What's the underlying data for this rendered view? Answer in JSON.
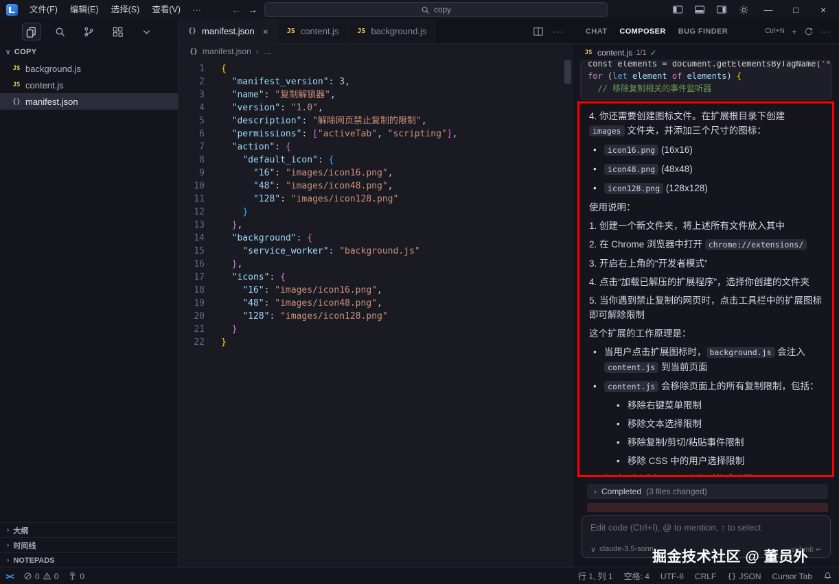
{
  "icons": {
    "js": "JS",
    "json": "{}"
  },
  "titlebar": {
    "menus": [
      "文件(F)",
      "编辑(E)",
      "选择(S)",
      "查看(V)"
    ],
    "more": "···",
    "back": "←",
    "forward": "→",
    "search_value": "copy",
    "window": {
      "minimize": "—",
      "maximize": "□",
      "close": "×"
    }
  },
  "sidebar": {
    "header": "COPY",
    "header_chevron": "∨",
    "files": [
      {
        "label": "background.js",
        "icon": "js"
      },
      {
        "label": "content.js",
        "icon": "js"
      },
      {
        "label": "manifest.json",
        "icon": "json",
        "active": true
      }
    ],
    "sections": [
      {
        "chevron": "›",
        "label": "大纲"
      },
      {
        "chevron": "›",
        "label": "时间线"
      },
      {
        "chevron": "›",
        "label": "NOTEPADS"
      }
    ]
  },
  "editor": {
    "tabs": [
      {
        "label": "manifest.json",
        "icon": "json",
        "active": true,
        "close": "×"
      },
      {
        "label": "content.js",
        "icon": "js"
      },
      {
        "label": "background.js",
        "icon": "js"
      }
    ],
    "breadcrumb": {
      "file": "manifest.json",
      "sep": "›",
      "more": "…"
    },
    "lines": [
      [
        [
          "b1",
          "{"
        ]
      ],
      [
        [
          "p",
          "  "
        ],
        [
          "k",
          "\"manifest_version\""
        ],
        [
          "p",
          ": "
        ],
        [
          "n",
          "3"
        ],
        [
          "p",
          ","
        ]
      ],
      [
        [
          "p",
          "  "
        ],
        [
          "k",
          "\"name\""
        ],
        [
          "p",
          ": "
        ],
        [
          "s",
          "\"复制解锁器\""
        ],
        [
          "p",
          ","
        ]
      ],
      [
        [
          "p",
          "  "
        ],
        [
          "k",
          "\"version\""
        ],
        [
          "p",
          ": "
        ],
        [
          "s",
          "\"1.0\""
        ],
        [
          "p",
          ","
        ]
      ],
      [
        [
          "p",
          "  "
        ],
        [
          "k",
          "\"description\""
        ],
        [
          "p",
          ": "
        ],
        [
          "s",
          "\"解除网页禁止复制的限制\""
        ],
        [
          "p",
          ","
        ]
      ],
      [
        [
          "p",
          "  "
        ],
        [
          "k",
          "\"permissions\""
        ],
        [
          "p",
          ": "
        ],
        [
          "b2",
          "["
        ],
        [
          "s",
          "\"activeTab\""
        ],
        [
          "p",
          ", "
        ],
        [
          "s",
          "\"scripting\""
        ],
        [
          "b2",
          "]"
        ],
        [
          "p",
          ","
        ]
      ],
      [
        [
          "p",
          "  "
        ],
        [
          "k",
          "\"action\""
        ],
        [
          "p",
          ": "
        ],
        [
          "b2",
          "{"
        ]
      ],
      [
        [
          "p",
          "    "
        ],
        [
          "k",
          "\"default_icon\""
        ],
        [
          "p",
          ": "
        ],
        [
          "b3",
          "{"
        ]
      ],
      [
        [
          "p",
          "      "
        ],
        [
          "k",
          "\"16\""
        ],
        [
          "p",
          ": "
        ],
        [
          "s",
          "\"images/icon16.png\""
        ],
        [
          "p",
          ","
        ]
      ],
      [
        [
          "p",
          "      "
        ],
        [
          "k",
          "\"48\""
        ],
        [
          "p",
          ": "
        ],
        [
          "s",
          "\"images/icon48.png\""
        ],
        [
          "p",
          ","
        ]
      ],
      [
        [
          "p",
          "      "
        ],
        [
          "k",
          "\"128\""
        ],
        [
          "p",
          ": "
        ],
        [
          "s",
          "\"images/icon128.png\""
        ]
      ],
      [
        [
          "p",
          "    "
        ],
        [
          "b3",
          "}"
        ]
      ],
      [
        [
          "p",
          "  "
        ],
        [
          "b2",
          "}"
        ],
        [
          "p",
          ","
        ]
      ],
      [
        [
          "p",
          "  "
        ],
        [
          "k",
          "\"background\""
        ],
        [
          "p",
          ": "
        ],
        [
          "b2",
          "{"
        ]
      ],
      [
        [
          "p",
          "    "
        ],
        [
          "k",
          "\"service_worker\""
        ],
        [
          "p",
          ": "
        ],
        [
          "s",
          "\"background.js\""
        ]
      ],
      [
        [
          "p",
          "  "
        ],
        [
          "b2",
          "}"
        ],
        [
          "p",
          ","
        ]
      ],
      [
        [
          "p",
          "  "
        ],
        [
          "k",
          "\"icons\""
        ],
        [
          "p",
          ": "
        ],
        [
          "b2",
          "{"
        ]
      ],
      [
        [
          "p",
          "    "
        ],
        [
          "k",
          "\"16\""
        ],
        [
          "p",
          ": "
        ],
        [
          "s",
          "\"images/icon16.png\""
        ],
        [
          "p",
          ","
        ]
      ],
      [
        [
          "p",
          "    "
        ],
        [
          "k",
          "\"48\""
        ],
        [
          "p",
          ": "
        ],
        [
          "s",
          "\"images/icon48.png\""
        ],
        [
          "p",
          ","
        ]
      ],
      [
        [
          "p",
          "    "
        ],
        [
          "k",
          "\"128\""
        ],
        [
          "p",
          ": "
        ],
        [
          "s",
          "\"images/icon128.png\""
        ]
      ],
      [
        [
          "p",
          "  "
        ],
        [
          "b2",
          "}"
        ]
      ],
      [
        [
          "b1",
          "}"
        ]
      ]
    ]
  },
  "composer": {
    "tabs": [
      {
        "label": "CHAT"
      },
      {
        "label": "COMPOSER",
        "active": true
      },
      {
        "label": "BUG FINDER"
      }
    ],
    "shortcut": "Ctrl+N",
    "plus": "+",
    "more": "···",
    "chip": {
      "name": "content.js",
      "count": "1/1",
      "check": "✓"
    },
    "snippet": [
      [
        [
          "pl",
          "const elements = document.getElementsByTagName("
        ],
        [
          "s",
          "'*'"
        ],
        [
          "pl",
          ");"
        ]
      ],
      [
        [
          "kw",
          "for"
        ],
        [
          "pl",
          " ("
        ],
        [
          "kw2",
          "let"
        ],
        [
          "vr",
          " element "
        ],
        [
          "kw",
          "of"
        ],
        [
          "vr",
          " elements"
        ],
        [
          "pl",
          ") "
        ],
        [
          "b1",
          "{"
        ]
      ],
      [
        [
          "cm",
          "  // 移除复制相关的事件监听器"
        ]
      ]
    ],
    "chat_blocks": [
      {
        "type": "p",
        "runs": [
          {
            "t": "4. 你还需要创建图标文件。在扩展根目录下创建 "
          },
          {
            "t": "images",
            "c": true
          },
          {
            "t": " 文件夹，并添加三个尺寸的图标："
          }
        ]
      },
      {
        "type": "li",
        "lvl": 1,
        "runs": [
          {
            "t": "icon16.png",
            "c": true
          },
          {
            "t": " (16x16)"
          }
        ]
      },
      {
        "type": "li",
        "lvl": 1,
        "runs": [
          {
            "t": "icon48.png",
            "c": true
          },
          {
            "t": " (48x48)"
          }
        ]
      },
      {
        "type": "li",
        "lvl": 1,
        "runs": [
          {
            "t": "icon128.png",
            "c": true
          },
          {
            "t": " (128x128)"
          }
        ]
      },
      {
        "type": "p",
        "runs": [
          {
            "t": "使用说明："
          }
        ]
      },
      {
        "type": "p",
        "runs": [
          {
            "t": "1. 创建一个新文件夹，将上述所有文件放入其中"
          }
        ]
      },
      {
        "type": "p",
        "runs": [
          {
            "t": "2. 在 Chrome 浏览器中打开 "
          },
          {
            "t": "chrome://extensions/",
            "c": true
          }
        ]
      },
      {
        "type": "p",
        "runs": [
          {
            "t": "3. 开启右上角的“开发者模式”"
          }
        ]
      },
      {
        "type": "p",
        "runs": [
          {
            "t": "4. 点击“加载已解压的扩展程序”，选择你创建的文件夹"
          }
        ]
      },
      {
        "type": "p",
        "runs": [
          {
            "t": "5. 当你遇到禁止复制的网页时，点击工具栏中的扩展图标即可解除限制"
          }
        ]
      },
      {
        "type": "p",
        "runs": [
          {
            "t": "这个扩展的工作原理是："
          }
        ]
      },
      {
        "type": "li",
        "lvl": 1,
        "runs": [
          {
            "t": "当用户点击扩展图标时，"
          },
          {
            "t": "background.js",
            "c": true
          },
          {
            "t": " 会注入 "
          },
          {
            "t": "content.js",
            "c": true
          },
          {
            "t": " 到当前页面"
          }
        ]
      },
      {
        "type": "li",
        "lvl": 1,
        "runs": [
          {
            "t": "content.js",
            "c": true
          },
          {
            "t": " 会移除页面上的所有复制限制，包括："
          }
        ]
      },
      {
        "type": "li",
        "lvl": 2,
        "runs": [
          {
            "t": "移除右键菜单限制"
          }
        ]
      },
      {
        "type": "li",
        "lvl": 2,
        "runs": [
          {
            "t": "移除文本选择限制"
          }
        ]
      },
      {
        "type": "li",
        "lvl": 2,
        "runs": [
          {
            "t": "移除复制/剪切/粘贴事件限制"
          }
        ]
      },
      {
        "type": "li",
        "lvl": 2,
        "runs": [
          {
            "t": "移除 CSS 中的用户选择限制"
          }
        ]
      },
      {
        "type": "li",
        "lvl": 1,
        "runs": [
          {
            "t": "解除限制后会显示一个临时的成功提示"
          }
        ]
      }
    ],
    "completed": {
      "chevron": "›",
      "label": "Completed",
      "detail": "(3 files changed)"
    },
    "input": {
      "placeholder": "Edit code (Ctrl+I), @ to mention, ↑ to select",
      "model_chevron": "∨",
      "model": "claude-3.5-sonn…",
      "submit": "submit ↵"
    }
  },
  "watermark": "掘金技术社区 @ 董员外",
  "statusbar": {
    "remote": "><",
    "errors": "0",
    "warnings": "0",
    "ports": "0",
    "right": [
      {
        "t": "行 1, 列 1"
      },
      {
        "t": "空格: 4"
      },
      {
        "t": "UTF-8"
      },
      {
        "t": "CRLF"
      },
      {
        "t": "JSON",
        "icon": "{}"
      },
      {
        "t": "Cursor Tab"
      }
    ]
  }
}
